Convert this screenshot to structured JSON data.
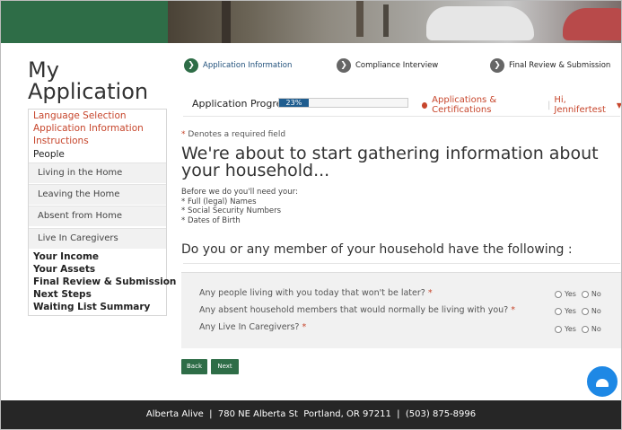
{
  "sidebar": {
    "title": "My Application",
    "links": [
      "Language Selection",
      "Application Information",
      "Instructions"
    ],
    "current_section": "People",
    "sub_items": [
      "Living in the Home",
      "Leaving the Home",
      "Absent from Home",
      "Live In Caregivers"
    ],
    "sections": [
      "Your Income",
      "Your Assets",
      "Final Review & Submission",
      "Next Steps",
      "Waiting List Summary"
    ]
  },
  "steps": [
    {
      "label": "Application Information",
      "state": "active"
    },
    {
      "label": "Compliance Interview",
      "state": "inactive"
    },
    {
      "label": "Final Review & Submission",
      "state": "inactive"
    }
  ],
  "progress": {
    "label": "Application Progress",
    "value_text": "23%",
    "value": 23
  },
  "topnav": {
    "applications": "Applications & Certifications",
    "user": "Hi, Jennifertest"
  },
  "content": {
    "required_note": "Denotes a required field",
    "heading": "We're about to start gathering information about your household...",
    "intro": [
      "Before we do you'll need your:",
      "* Full (legal) Names",
      "* Social Security Numbers",
      "* Dates of Birth"
    ],
    "question_heading": "Do you or any member of your household have the following :",
    "questions": [
      "Any people living with you today that won't be later?",
      "Any absent household members that would normally be living with you?",
      "Any Live In Caregivers?"
    ],
    "yes_label": "Yes",
    "no_label": "No"
  },
  "buttons": {
    "back": "Back",
    "next": "Next"
  },
  "footer": {
    "text": "Alberta Alive  |  780 NE Alberta St  Portland, OR 97211  |  (503) 875-8996"
  },
  "colors": {
    "brand_green": "#2e6d47",
    "accent_red": "#c7462c",
    "progress_blue": "#1f5d8f",
    "footer_bg": "#262626",
    "fab_blue": "#1e88e5"
  },
  "icons": {
    "step_active": "chevron-right-icon",
    "step_inactive": "chevron-right-icon",
    "fab": "bell-icon"
  }
}
